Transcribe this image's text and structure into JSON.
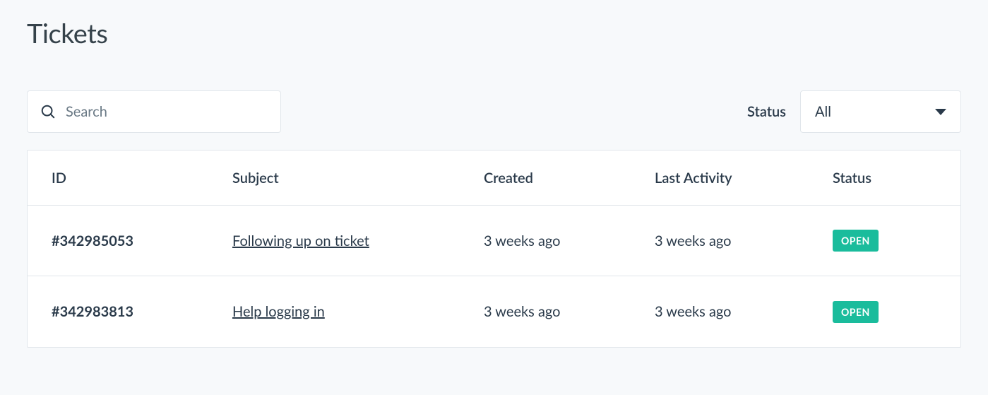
{
  "page": {
    "title": "Tickets"
  },
  "search": {
    "placeholder": "Search",
    "value": ""
  },
  "filter": {
    "label": "Status",
    "selected": "All"
  },
  "table": {
    "headers": {
      "id": "ID",
      "subject": "Subject",
      "created": "Created",
      "activity": "Last Activity",
      "status": "Status"
    },
    "rows": [
      {
        "id": "#342985053",
        "subject": "Following up on ticket",
        "created": "3 weeks ago",
        "activity": "3 weeks ago",
        "status": "OPEN"
      },
      {
        "id": "#342983813",
        "subject": "Help logging in",
        "created": "3 weeks ago",
        "activity": "3 weeks ago",
        "status": "OPEN"
      }
    ]
  }
}
